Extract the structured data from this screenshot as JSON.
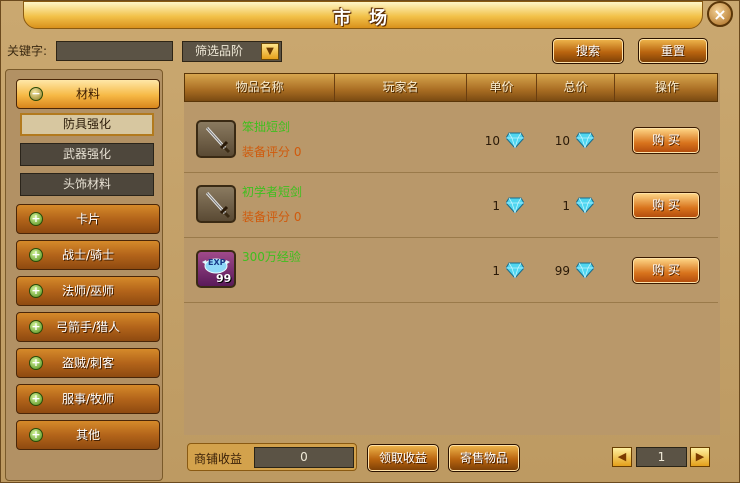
{
  "window": {
    "title": "市 场",
    "close": "×"
  },
  "search": {
    "keyword_label": "关键字:",
    "keyword_value": "",
    "filter_label": "筛选品阶",
    "filter_arrow": "▼",
    "search_button": "搜索",
    "reset_button": "重置"
  },
  "sidebar": {
    "expanded": {
      "label": "材料",
      "toggle": "−"
    },
    "subitems": [
      "防具强化",
      "武器强化",
      "头饰材料"
    ],
    "categories": [
      {
        "label": "卡片",
        "toggle": "+"
      },
      {
        "label": "战士/骑士",
        "toggle": "+"
      },
      {
        "label": "法师/巫师",
        "toggle": "+"
      },
      {
        "label": "弓箭手/猎人",
        "toggle": "+"
      },
      {
        "label": "盗贼/刺客",
        "toggle": "+"
      },
      {
        "label": "服事/牧师",
        "toggle": "+"
      },
      {
        "label": "其他",
        "toggle": "+"
      }
    ]
  },
  "table": {
    "headers": [
      "物品名称",
      "玩家名",
      "单价",
      "总价",
      "操作"
    ],
    "rows": [
      {
        "name": "笨拙短剑",
        "score_label": "装备评分",
        "score": "0",
        "player": "",
        "unit_price": "10",
        "total_price": "10",
        "buy": "购 买",
        "icon": "dagger-icon"
      },
      {
        "name": "初学者短剑",
        "score_label": "装备评分",
        "score": "0",
        "player": "",
        "unit_price": "1",
        "total_price": "1",
        "buy": "购 买",
        "icon": "dagger-icon"
      },
      {
        "name": "300万经验",
        "score_label": "",
        "score": "",
        "player": "",
        "unit_price": "1",
        "total_price": "99",
        "buy": "购 买",
        "icon": "exp-icon",
        "badge": "EXP",
        "count": "99"
      }
    ]
  },
  "footer": {
    "shop_income_label": "商铺收益",
    "shop_income_value": "0",
    "collect_button": "领取收益",
    "consign_button": "寄售物品",
    "page": "1",
    "prev": "◀",
    "next": "▶"
  },
  "colors": {
    "accent": "#d8731c",
    "item_green": "#3fbf1f",
    "score_orange": "#d05a0c",
    "gem": "#4fd6f0"
  }
}
